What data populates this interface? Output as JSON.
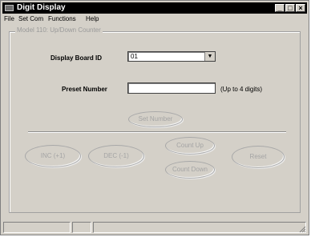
{
  "window": {
    "title": "Digit Display"
  },
  "menu": {
    "items": [
      "File",
      "Set Com",
      "Functions",
      "Help"
    ]
  },
  "group": {
    "label": "Model 110: Up/Down Counter"
  },
  "display": {
    "label": "Display Board ID",
    "value": "01"
  },
  "preset": {
    "label": "Preset Number",
    "value": "",
    "hint": "(Up to 4 digits)"
  },
  "buttons": {
    "set_number": "Set Number",
    "inc": "INC (+1)",
    "dec": "DEC (-1)",
    "count_up": "Count Up",
    "count_down": "Count Down",
    "reset": "Reset"
  }
}
